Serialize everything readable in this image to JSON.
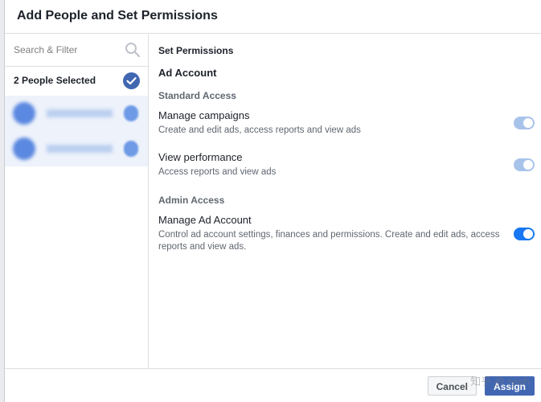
{
  "dialog": {
    "title": "Add People and Set Permissions"
  },
  "left_panel": {
    "search_placeholder": "Search & Filter",
    "selected_label": "2 People Selected"
  },
  "right_panel": {
    "section_title": "Set Permissions",
    "account_title": "Ad Account",
    "groups": [
      {
        "label": "Standard Access",
        "permissions": [
          {
            "name": "Manage campaigns",
            "description": "Create and edit ads, access reports and view ads",
            "state": "enabled-locked"
          },
          {
            "name": "View performance",
            "description": "Access reports and view ads",
            "state": "enabled-locked"
          }
        ]
      },
      {
        "label": "Admin Access",
        "permissions": [
          {
            "name": "Manage Ad Account",
            "description": "Control ad account settings, finances and permissions. Create and edit ads, access reports and view ads.",
            "state": "on"
          }
        ]
      }
    ]
  },
  "footer": {
    "cancel_label": "Cancel",
    "assign_label": "Assign",
    "watermark": "知乎 @ rywh"
  },
  "colors": {
    "primary": "#4267b2",
    "toggle_on": "#1877f2",
    "toggle_faded": "#a8c3ea",
    "selected_bg": "#edf2fb"
  }
}
